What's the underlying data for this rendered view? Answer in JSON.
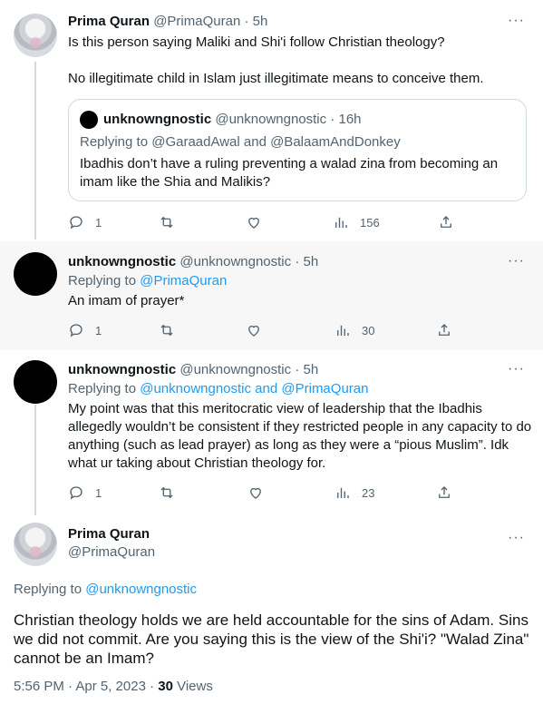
{
  "tweets": [
    {
      "name": "Prima Quran",
      "handle": "@PrimaQuran",
      "time": "5h",
      "text1": "Is this person saying Maliki and Shi'i follow Christian theology?",
      "text2": "No illegitimate child in Islam just illegitimate means to conceive them.",
      "quote": {
        "name": "unknowngnostic",
        "handle": "@unknowngnostic",
        "time": "16h",
        "reply_prefix": "Replying to ",
        "reply_targets": "@GaraadAwal and @BalaamAndDonkey",
        "text": "Ibadhis don’t have a ruling preventing a walad zina from becoming an imam like the Shia and Malikis?"
      },
      "replies": "1",
      "retweets": "",
      "likes": "",
      "views": "156"
    },
    {
      "name": "unknowngnostic",
      "handle": "@unknowngnostic",
      "time": "5h",
      "reply_prefix": "Replying to ",
      "reply_targets": "@PrimaQuran",
      "text": "An imam of prayer*",
      "replies": "1",
      "views": "30"
    },
    {
      "name": "unknowngnostic",
      "handle": "@unknowngnostic",
      "time": "5h",
      "reply_prefix": "Replying to ",
      "reply_targets": "@unknowngnostic and @PrimaQuran",
      "text": "My point was that this meritocratic view of leadership that the Ibadhis allegedly wouldn’t be consistent if they restricted people in any capacity to do anything (such as lead prayer) as long as they were a “pious Muslim”. Idk what ur taking about Christian theology for.",
      "replies": "1",
      "views": "23"
    }
  ],
  "main": {
    "name": "Prima Quran",
    "handle": "@PrimaQuran",
    "reply_prefix": "Replying to ",
    "reply_target": "@unknowngnostic",
    "text": "Christian theology holds we are held accountable for the sins of Adam. Sins we did not commit. Are you saying this is the view of the Shi'i? \"Walad Zina\" cannot be an Imam?",
    "timestamp": "5:56 PM · Apr 5, 2023 · ",
    "views_count": "30",
    "views_label": " Views"
  },
  "separator": " · ",
  "more_glyph": "···",
  "colors": {
    "link": "#1d9bf0",
    "muted": "#536471",
    "text": "#0f1419",
    "border": "#cfd9de",
    "highlight_bg": "#f7f7f7"
  }
}
